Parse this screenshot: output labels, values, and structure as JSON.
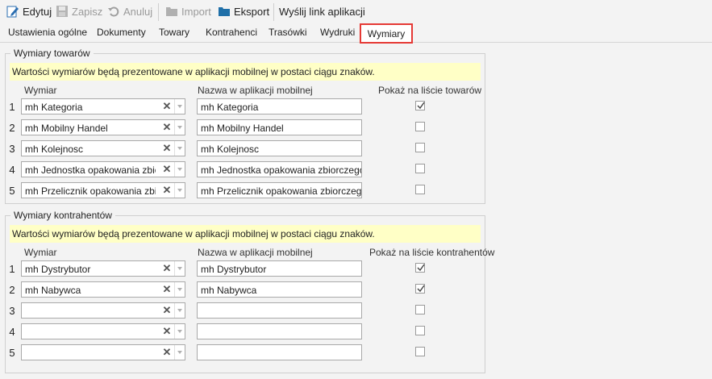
{
  "toolbar": {
    "edit": "Edytuj",
    "save": "Zapisz",
    "cancel": "Anuluj",
    "import": "Import",
    "export": "Eksport",
    "send_link": "Wyślij link aplikacji"
  },
  "tabs": [
    "Ustawienia ogólne",
    "Dokumenty",
    "Towary",
    "Kontrahenci",
    "Trasówki",
    "Wydruki",
    "Wymiary"
  ],
  "active_tab": "Wymiary",
  "goods": {
    "legend": "Wymiary towarów",
    "note": "Wartości wymiarów będą prezentowane w aplikacji mobilnej w postaci ciągu znaków.",
    "col_dimension": "Wymiar",
    "col_mobile_name": "Nazwa w aplikacji mobilnej",
    "col_show": "Pokaż na liście towarów",
    "rows": [
      {
        "num": "1",
        "dimension": "mh Kategoria",
        "mobile_name": "mh Kategoria",
        "checked": true
      },
      {
        "num": "2",
        "dimension": "mh Mobilny Handel",
        "mobile_name": "mh Mobilny Handel",
        "checked": false
      },
      {
        "num": "3",
        "dimension": "mh Kolejnosc",
        "mobile_name": "mh Kolejnosc",
        "checked": false
      },
      {
        "num": "4",
        "dimension": "mh Jednostka opakowania zbiorczego",
        "mobile_name": "mh Jednostka opakowania zbiorczego",
        "checked": false
      },
      {
        "num": "5",
        "dimension": "mh Przelicznik opakowania zbiorczego",
        "mobile_name": "mh Przelicznik opakowania zbiorczego",
        "checked": false
      }
    ]
  },
  "contractors": {
    "legend": "Wymiary kontrahentów",
    "note": "Wartości wymiarów będą prezentowane w aplikacji mobilnej w postaci ciągu znaków.",
    "col_dimension": "Wymiar",
    "col_mobile_name": "Nazwa w aplikacji mobilnej",
    "col_show": "Pokaż na liście kontrahentów",
    "rows": [
      {
        "num": "1",
        "dimension": "mh Dystrybutor",
        "mobile_name": "mh Dystrybutor",
        "checked": true
      },
      {
        "num": "2",
        "dimension": "mh Nabywca",
        "mobile_name": "mh Nabywca",
        "checked": true
      },
      {
        "num": "3",
        "dimension": "",
        "mobile_name": "",
        "checked": false
      },
      {
        "num": "4",
        "dimension": "",
        "mobile_name": "",
        "checked": false
      },
      {
        "num": "5",
        "dimension": "",
        "mobile_name": "",
        "checked": false
      }
    ]
  },
  "colors": {
    "active_tab_border": "#e53935",
    "note_bg": "#ffffc6",
    "export_icon": "#1f6fa8"
  }
}
